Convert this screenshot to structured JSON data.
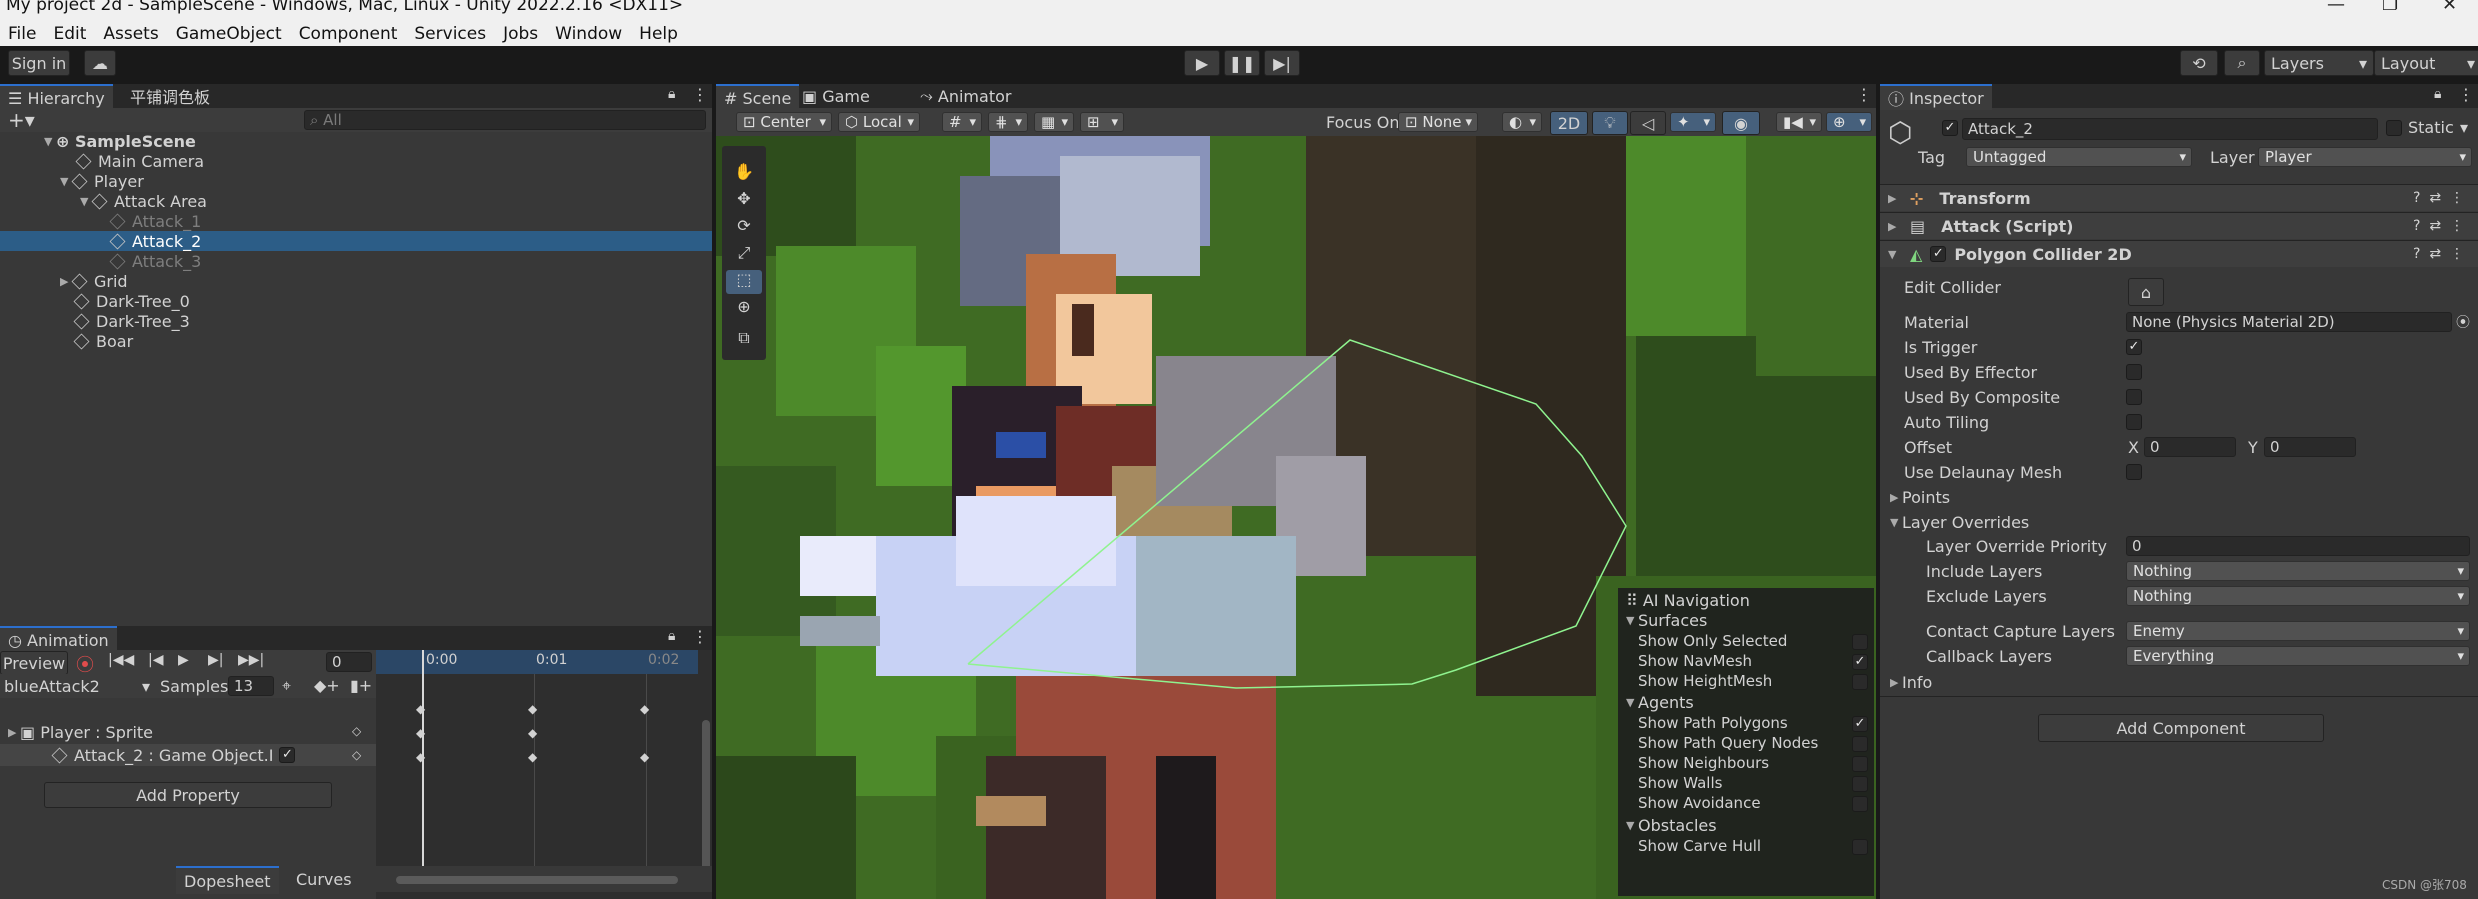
{
  "window": {
    "title": "My project 2d - SampleScene - Windows, Mac, Linux - Unity 2022.2.16 <DX11>"
  },
  "menu": [
    "File",
    "Edit",
    "Assets",
    "GameObject",
    "Component",
    "Services",
    "Jobs",
    "Window",
    "Help"
  ],
  "toolbar": {
    "sign_in": "Sign in",
    "layers": "Layers",
    "layout": "Layout"
  },
  "hierarchy": {
    "tab": "Hierarchy",
    "tab2": "平铺调色板",
    "search_placeholder": "All",
    "items": [
      {
        "label": "SampleScene"
      },
      {
        "label": "Main Camera"
      },
      {
        "label": "Player"
      },
      {
        "label": "Attack Area"
      },
      {
        "label": "Attack_1"
      },
      {
        "label": "Attack_2"
      },
      {
        "label": "Attack_3"
      },
      {
        "label": "Grid"
      },
      {
        "label": "Dark-Tree_0"
      },
      {
        "label": "Dark-Tree_3"
      },
      {
        "label": "Boar"
      }
    ]
  },
  "scene": {
    "tabs": [
      "Scene",
      "Game",
      "Animator"
    ],
    "pivot": "Center",
    "space": "Local",
    "focus_on": "Focus On",
    "focus_value": "None",
    "mode_2d": "2D"
  },
  "ai_nav": {
    "title": "AI Navigation",
    "surfaces": "Surfaces",
    "show_only_selected": "Show Only Selected",
    "show_navmesh": "Show NavMesh",
    "show_heightmesh": "Show HeightMesh",
    "agents": "Agents",
    "show_path_polygons": "Show Path Polygons",
    "show_path_query": "Show Path Query Nodes",
    "show_neighbours": "Show Neighbours",
    "show_walls": "Show Walls",
    "show_avoidance": "Show Avoidance",
    "obstacles": "Obstacles",
    "show_carve_hull": "Show Carve Hull"
  },
  "animation": {
    "tab": "Animation",
    "preview": "Preview",
    "frame": "0",
    "clip": "blueAttack2",
    "samples_label": "Samples",
    "samples": "13",
    "time0": "0:00",
    "time1": "0:01",
    "time2": "0:02",
    "track1": "Player : Sprite",
    "track2": "Attack_2 : Game Object.I",
    "add_property": "Add Property",
    "dopesheet": "Dopesheet",
    "curves": "Curves"
  },
  "inspector": {
    "tab": "Inspector",
    "object_name": "Attack_2",
    "static": "Static",
    "tag_label": "Tag",
    "tag": "Untagged",
    "layer_label": "Layer",
    "layer": "Player",
    "transform": "Transform",
    "attack_script": "Attack (Script)",
    "polygon": "Polygon Collider 2D",
    "edit_collider": "Edit Collider",
    "material_label": "Material",
    "material": "None (Physics Material 2D)",
    "is_trigger": "Is Trigger",
    "used_by_effector": "Used By Effector",
    "used_by_composite": "Used By Composite",
    "auto_tiling": "Auto Tiling",
    "offset": "Offset",
    "x_label": "X",
    "x": "0",
    "y_label": "Y",
    "y": "0",
    "delaunay": "Use Delaunay Mesh",
    "points": "Points",
    "layer_overrides": "Layer Overrides",
    "priority_label": "Layer Override Priority",
    "priority": "0",
    "include_label": "Include Layers",
    "include": "Nothing",
    "exclude_label": "Exclude Layers",
    "exclude": "Nothing",
    "contact_label": "Contact Capture Layers",
    "contact": "Enemy",
    "callback_label": "Callback Layers",
    "callback": "Everything",
    "info": "Info",
    "add_component": "Add Component"
  },
  "watermark": "CSDN @张708"
}
